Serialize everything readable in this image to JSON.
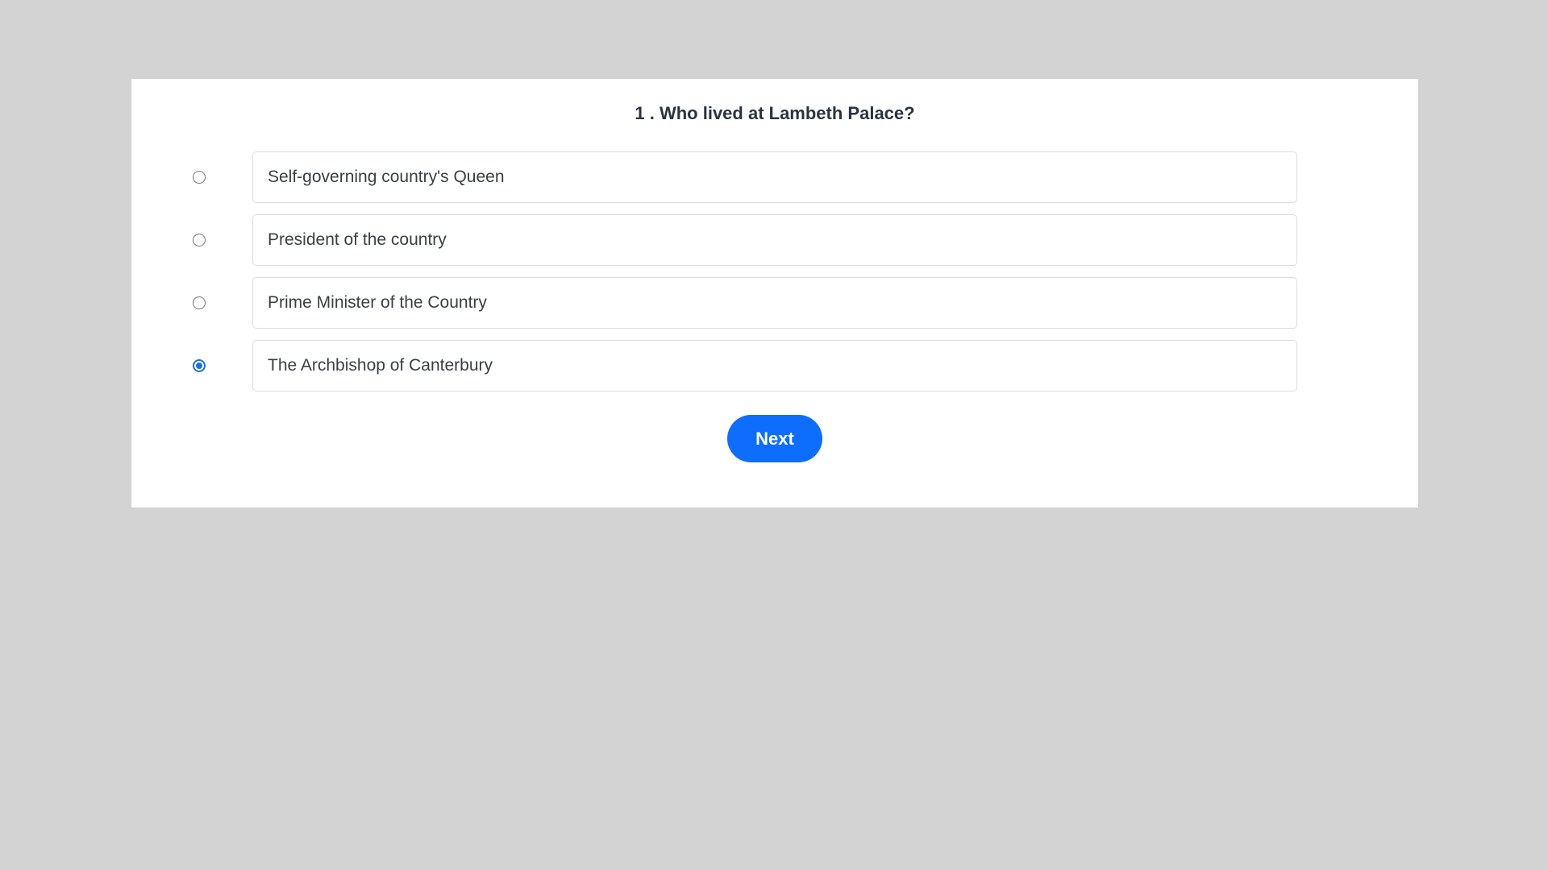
{
  "question": {
    "text": "1 . Who lived at Lambeth Palace?"
  },
  "options": [
    {
      "label": "Self-governing country's Queen",
      "selected": false
    },
    {
      "label": "President of the country",
      "selected": false
    },
    {
      "label": "Prime Minister of the Country",
      "selected": false
    },
    {
      "label": "The Archbishop of Canterbury",
      "selected": true
    }
  ],
  "actions": {
    "next_label": "Next"
  },
  "colors": {
    "background": "#d3d3d3",
    "card": "#ffffff",
    "accent": "#0d6efd",
    "radio_checked": "#1a73e8"
  }
}
